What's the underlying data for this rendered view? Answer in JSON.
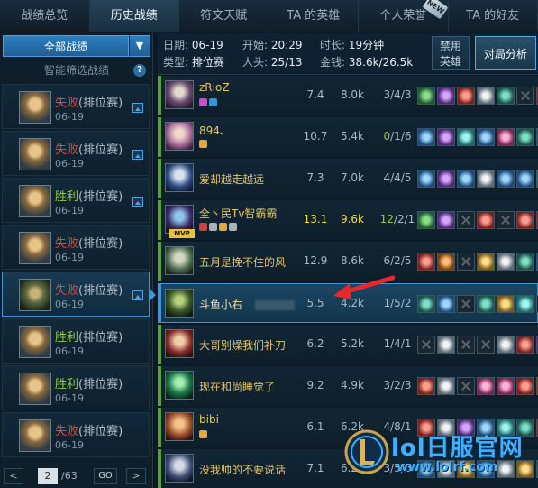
{
  "tabs": [
    {
      "label": "战绩总览",
      "active": false
    },
    {
      "label": "历史战绩",
      "active": true
    },
    {
      "label": "符文天赋",
      "active": false
    },
    {
      "label": "TA 的英雄",
      "active": false
    },
    {
      "label": "个人荣誉",
      "active": false,
      "badge": "NEW"
    },
    {
      "label": "TA 的好友",
      "active": false
    }
  ],
  "filter": {
    "selected": "全部战绩",
    "smart_label": "智能筛选战绩",
    "help": "?"
  },
  "matches": [
    {
      "result": "失败",
      "type": "(排位赛)",
      "date": "06-19",
      "win": false
    },
    {
      "result": "失败",
      "type": "(排位赛)",
      "date": "06-19",
      "win": false
    },
    {
      "result": "胜利",
      "type": "(排位赛)",
      "date": "06-19",
      "win": true
    },
    {
      "result": "失败",
      "type": "(排位赛)",
      "date": "06-19",
      "win": false
    },
    {
      "result": "失败",
      "type": "(排位赛)",
      "date": "06-19",
      "win": false,
      "selected": true
    },
    {
      "result": "胜利",
      "type": "(排位赛)",
      "date": "06-19",
      "win": true
    },
    {
      "result": "胜利",
      "type": "(排位赛)",
      "date": "06-19",
      "win": true
    },
    {
      "result": "失败",
      "type": "(排位赛)",
      "date": "06-19",
      "win": false
    }
  ],
  "pager": {
    "prev": "<",
    "current": "2",
    "total": "/63",
    "go": "GO",
    "next": ">"
  },
  "summary": {
    "date_label": "日期:",
    "date": "06-19",
    "start_label": "开始:",
    "start": "20:29",
    "duration_label": "时长:",
    "duration": "19分钟",
    "type_label": "类型:",
    "type": "排位赛",
    "kills_label": "人头:",
    "kills": "25/13",
    "gold_label": "金钱:",
    "gold": "38.6k/26.5k",
    "ban_line1": "禁用",
    "ban_line2": "英雄",
    "analysis": "对局分析"
  },
  "players": [
    {
      "name": "zRioZ",
      "score": "7.4",
      "gold": "8.0k",
      "kda": "3/4/3",
      "items": [
        "green",
        "purple",
        "red",
        "silver",
        "teal",
        "empty",
        "red"
      ]
    },
    {
      "name": "894、",
      "score": "10.7",
      "gold": "5.4k",
      "kda_a": "0",
      "kda_b": "/1/6",
      "items": [
        "blue",
        "purple",
        "cyan",
        "blue",
        "pink",
        "teal",
        "blue"
      ]
    },
    {
      "name": "爱却越走越远",
      "score": "7.3",
      "gold": "7.0k",
      "kda": "4/4/5",
      "items": [
        "blue",
        "purple",
        "blue",
        "silver",
        "blue",
        "blue",
        "cyan"
      ]
    },
    {
      "name": "全丶民Tv智霸霸",
      "score": "13.1",
      "gold": "9.6k",
      "kda_a": "12",
      "kda_b": "/2/1",
      "items": [
        "green",
        "purple",
        "empty",
        "red",
        "empty",
        "red",
        "red"
      ],
      "mvp": "MVP"
    },
    {
      "name": "五月是挽不住的风",
      "score": "12.9",
      "gold": "8.6k",
      "kda": "6/2/5",
      "items": [
        "red",
        "orange",
        "empty",
        "gold",
        "silver",
        "teal",
        "blue"
      ]
    },
    {
      "name": "斗鱼小右",
      "score": "5.5",
      "gold": "4.2k",
      "kda": "1/5/2",
      "items": [
        "teal",
        "blue",
        "empty",
        "teal",
        "gold",
        "cyan",
        "empty"
      ],
      "me": true
    },
    {
      "name": "大哥别燥我们补刀",
      "score": "6.2",
      "gold": "5.2k",
      "kda": "1/4/1",
      "items": [
        "empty",
        "silver",
        "empty",
        "empty",
        "silver",
        "red",
        "purple"
      ]
    },
    {
      "name": "现在和尚睡觉了",
      "score": "9.2",
      "gold": "4.9k",
      "kda": "3/2/3",
      "items": [
        "red",
        "silver",
        "empty",
        "pink",
        "pink",
        "red",
        "orange"
      ]
    },
    {
      "name": "bibi",
      "score": "6.1",
      "gold": "6.2k",
      "kda": "4/8/1",
      "items": [
        "red",
        "silver",
        "purple",
        "blue",
        "cyan",
        "teal",
        "red"
      ]
    },
    {
      "name": "没我帅的不要说话",
      "score": "7.1",
      "gold": "6.2k",
      "kda": "3/5/6",
      "items": [
        "blue",
        "silver",
        "gold",
        "blue",
        "silver",
        "gold",
        "teal"
      ]
    }
  ],
  "watermark": {
    "title": "lol日服官网",
    "url": "www.lolrf.com"
  }
}
